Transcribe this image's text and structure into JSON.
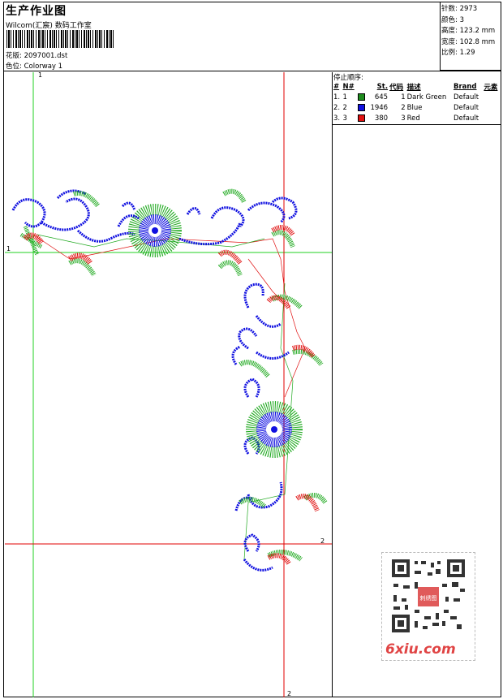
{
  "header": {
    "title": "生产作业图",
    "company": "Wilcom(汇宸) 数码工作室",
    "design_label": "花版: 2097001.dst",
    "colorway_label": "色位: Colorway 1"
  },
  "stats": {
    "stitches": "针数: 2973",
    "colors": "颜色: 3",
    "height": "高度: 123.2 mm",
    "width": "宽度: 102.8 mm",
    "ratio": "比例: 1.29"
  },
  "stop_sequence": {
    "heading": "停止顺序:",
    "columns": [
      "#",
      "N#",
      "St.",
      "代码",
      "描述",
      "Brand",
      "元素"
    ],
    "rows": [
      {
        "idx": "1.",
        "n": "1",
        "color": "#1f8c1f",
        "st": "645",
        "code": "1",
        "desc": "Dark Green",
        "brand": "Default"
      },
      {
        "idx": "2.",
        "n": "2",
        "color": "#1010e0",
        "st": "1946",
        "code": "2",
        "desc": "Blue",
        "brand": "Default"
      },
      {
        "idx": "3.",
        "n": "3",
        "color": "#e01010",
        "st": "380",
        "code": "3",
        "desc": "Red",
        "brand": "Default"
      }
    ]
  },
  "guides": {
    "green_v_label": "1",
    "green_h_label": "1",
    "red_h_label": "2",
    "red_v_label": "2"
  },
  "colors": {
    "green": "#22aa22",
    "blue": "#1010e0",
    "red": "#e01010",
    "guide_green": "#20d020",
    "guide_red": "#e00000"
  },
  "watermark": {
    "site": "6xiu.com",
    "qr_stamp": "刺绣图"
  }
}
